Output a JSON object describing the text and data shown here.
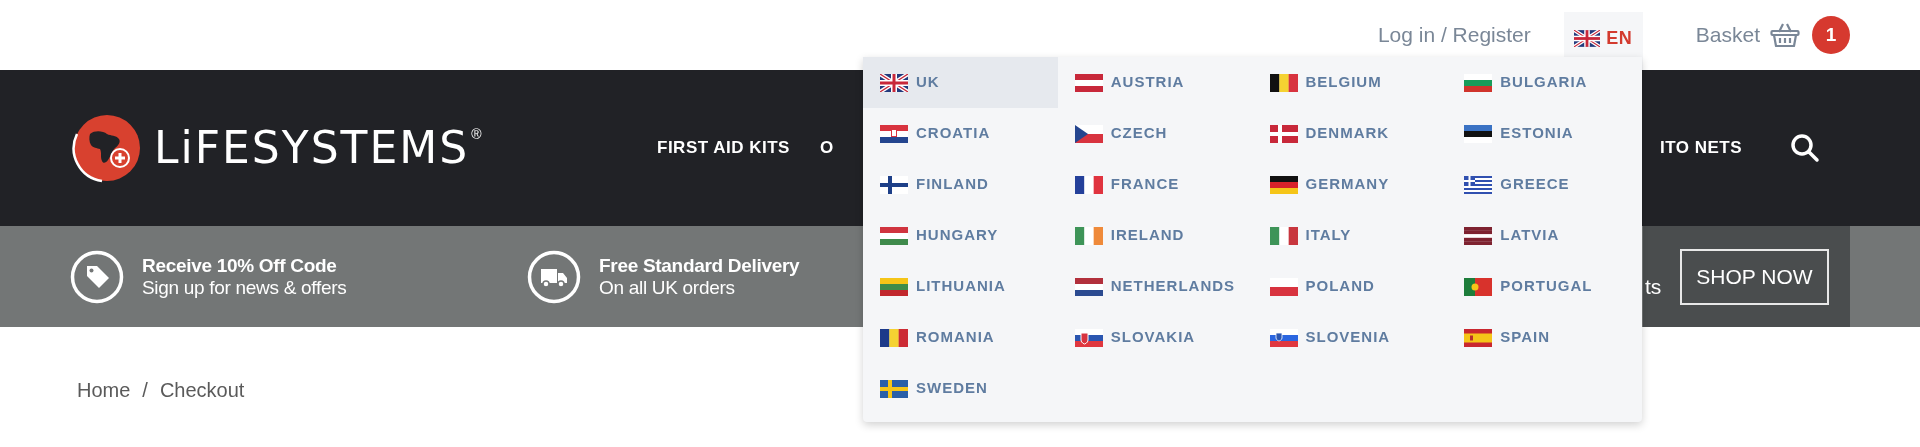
{
  "top_bar": {
    "login": "Log in / Register",
    "language": {
      "code": "EN",
      "expanded": true
    },
    "basket": {
      "label": "Basket",
      "count": "1"
    }
  },
  "header": {
    "logo_text": "LiFESYSTEMS",
    "registered_mark": "®",
    "nav": [
      {
        "label": "FIRST AID KITS"
      },
      {
        "label": "O"
      },
      {
        "label": "ITO NETS"
      }
    ]
  },
  "promo_bar": {
    "items": [
      {
        "kind": "tag",
        "title": "Receive 10% Off Code",
        "subtitle": "Sign up for news & offers"
      },
      {
        "kind": "truck",
        "title": "Free Standard Delivery",
        "subtitle": "On all UK orders"
      }
    ],
    "cut_text": "ts",
    "button": "SHOP NOW"
  },
  "breadcrumb": {
    "items": [
      "Home",
      "Checkout"
    ],
    "separator": "/"
  },
  "language_menu": {
    "items": [
      {
        "label": "UK",
        "selected": true
      },
      {
        "label": "AUSTRIA",
        "selected": false
      },
      {
        "label": "BELGIUM",
        "selected": false
      },
      {
        "label": "BULGARIA",
        "selected": false
      },
      {
        "label": "CROATIA",
        "selected": false
      },
      {
        "label": "CZECH",
        "selected": false
      },
      {
        "label": "DENMARK",
        "selected": false
      },
      {
        "label": "ESTONIA",
        "selected": false
      },
      {
        "label": "FINLAND",
        "selected": false
      },
      {
        "label": "FRANCE",
        "selected": false
      },
      {
        "label": "GERMANY",
        "selected": false
      },
      {
        "label": "GREECE",
        "selected": false
      },
      {
        "label": "HUNGARY",
        "selected": false
      },
      {
        "label": "IRELAND",
        "selected": false
      },
      {
        "label": "ITALY",
        "selected": false
      },
      {
        "label": "LATVIA",
        "selected": false
      },
      {
        "label": "LITHUANIA",
        "selected": false
      },
      {
        "label": "NETHERLANDS",
        "selected": false
      },
      {
        "label": "POLAND",
        "selected": false
      },
      {
        "label": "PORTUGAL",
        "selected": false
      },
      {
        "label": "ROMANIA",
        "selected": false
      },
      {
        "label": "SLOVAKIA",
        "selected": false
      },
      {
        "label": "SLOVENIA",
        "selected": false
      },
      {
        "label": "SPAIN",
        "selected": false
      },
      {
        "label": "SWEDEN",
        "selected": false
      }
    ]
  }
}
